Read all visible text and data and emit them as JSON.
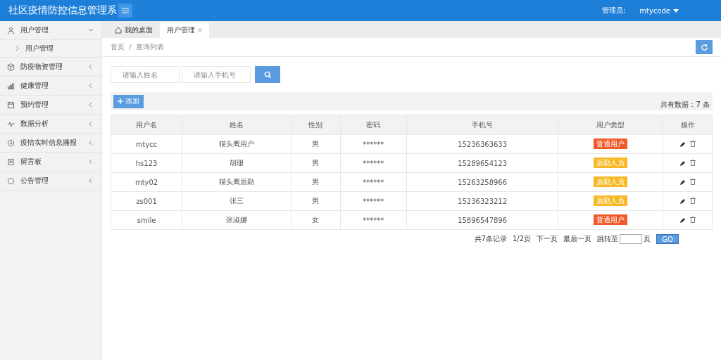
{
  "header": {
    "title": "社区疫情防控信息管理系",
    "admin_label": "管理员:",
    "admin_name": "mtycode"
  },
  "sidebar": {
    "items": [
      {
        "label": "用户管理",
        "expanded": true,
        "children": [
          {
            "label": "用户管理"
          }
        ]
      },
      {
        "label": "防疫物资管理",
        "expanded": false
      },
      {
        "label": "健康管理",
        "expanded": false
      },
      {
        "label": "预约管理",
        "expanded": false
      },
      {
        "label": "数据分析",
        "expanded": false
      },
      {
        "label": "疫情实时信息播报",
        "expanded": false
      },
      {
        "label": "留言板",
        "expanded": false
      },
      {
        "label": "公告管理",
        "expanded": false
      }
    ]
  },
  "tabs": [
    {
      "label": "我的桌面",
      "selected": false
    },
    {
      "label": "用户管理",
      "selected": true
    }
  ],
  "breadcrumb": [
    "首页",
    "查询列表"
  ],
  "search": {
    "name_placeholder": "请输入姓名",
    "phone_placeholder": "请输入手机号"
  },
  "toolbar": {
    "add_label": "添加",
    "count": "共有数据：7 条"
  },
  "table": {
    "columns": [
      "用户名",
      "姓名",
      "性别",
      "密码",
      "手机号",
      "用户类型",
      "操作"
    ],
    "rows": [
      {
        "username": "mtycc",
        "name": "猫头鹰用户",
        "gender": "男",
        "password": "******",
        "phone": "15236363633",
        "type": "普通用户",
        "color": "#f05a28"
      },
      {
        "username": "hs123",
        "name": "胡珊",
        "gender": "男",
        "password": "******",
        "phone": "15289654123",
        "type": "后勤人员",
        "color": "#f7b824"
      },
      {
        "username": "mty02",
        "name": "猫头鹰后勤",
        "gender": "男",
        "password": "******",
        "phone": "15263258966",
        "type": "后勤人员",
        "color": "#f7b824"
      },
      {
        "username": "zs001",
        "name": "张三",
        "gender": "男",
        "password": "******",
        "phone": "15236323212",
        "type": "后勤人员",
        "color": "#f7b824"
      },
      {
        "username": "smile",
        "name": "张淑娜",
        "gender": "女",
        "password": "******",
        "phone": "15896547896",
        "type": "普通用户",
        "color": "#f05a28"
      }
    ]
  },
  "pagination": {
    "records": "共7条记录",
    "page": "1/2页",
    "next": "下一页",
    "last": "最后一页",
    "jump": "跳转至",
    "unit": "页",
    "go": "GO"
  }
}
